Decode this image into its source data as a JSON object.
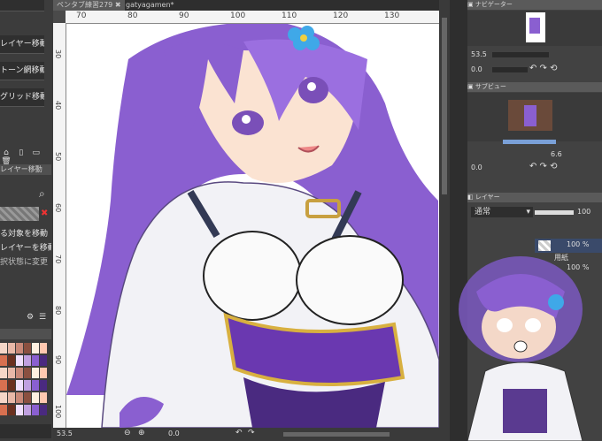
{
  "left_panel": {
    "buttons": [
      "レイヤー移動",
      "トーン網移動",
      "グリッド移動"
    ],
    "sub_title": "レイヤー移動",
    "options": [
      "る対象を移動",
      "レイヤーを移動",
      "択状態に変更"
    ]
  },
  "tabs": [
    {
      "label": "ペンタブ練習279",
      "close": "✖"
    },
    {
      "label": "gatyagamen*"
    }
  ],
  "ruler_top": [
    "70",
    "80",
    "90",
    "100",
    "110",
    "120",
    "130"
  ],
  "ruler_left": [
    "30",
    "40",
    "50",
    "60",
    "70",
    "80",
    "90",
    "100"
  ],
  "status": {
    "zoom": "53.5",
    "angle": "0.0"
  },
  "navigator": {
    "title": "ナビゲーター",
    "zoom": "53.5",
    "angle": "0.0"
  },
  "subview": {
    "title": "サブビュー",
    "zoom": "6.6",
    "angle": "0.0"
  },
  "layer": {
    "title": "レイヤー",
    "blend_mode": "通常",
    "opacity": "100",
    "layers": [
      {
        "opacity": "100 %",
        "name": "用紙"
      },
      {
        "opacity": "100 %",
        "name": ""
      }
    ]
  },
  "colors": {
    "accent": "#7aa0d8",
    "hair": "#8a5fd0",
    "flower": "#3fa8e8"
  }
}
